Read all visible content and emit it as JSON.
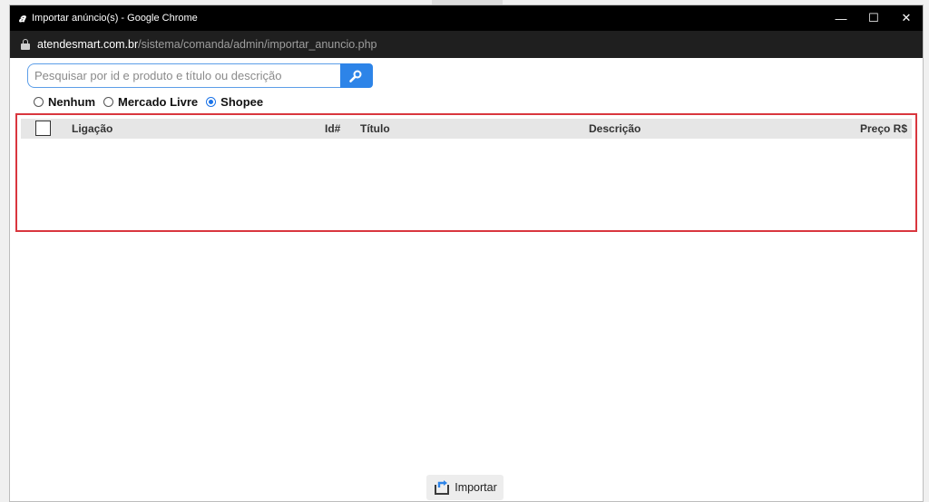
{
  "window": {
    "title": "Importar anúncio(s) - Google Chrome",
    "controls": {
      "minimize": "—",
      "maximize": "☐",
      "close": "✕"
    }
  },
  "address": {
    "host": "atendesmart.com.br",
    "path": "/sistema/comanda/admin/importar_anuncio.php"
  },
  "search": {
    "placeholder": "Pesquisar por id e produto e título ou descrição",
    "value": ""
  },
  "filters": {
    "options": [
      {
        "label": "Nenhum",
        "checked": false
      },
      {
        "label": "Mercado Livre",
        "checked": false
      },
      {
        "label": "Shopee",
        "checked": true
      }
    ]
  },
  "table": {
    "columns": [
      "Ligação",
      "Id#",
      "Título",
      "Descrição",
      "Preço R$"
    ],
    "rows": []
  },
  "actions": {
    "import_label": "Importar"
  },
  "colors": {
    "accent": "#2d84e8",
    "highlight_border": "#d9363e",
    "titlebar": "#000000"
  },
  "icons": {
    "search": "search-icon",
    "import": "import-icon",
    "lock": "lock-icon"
  }
}
